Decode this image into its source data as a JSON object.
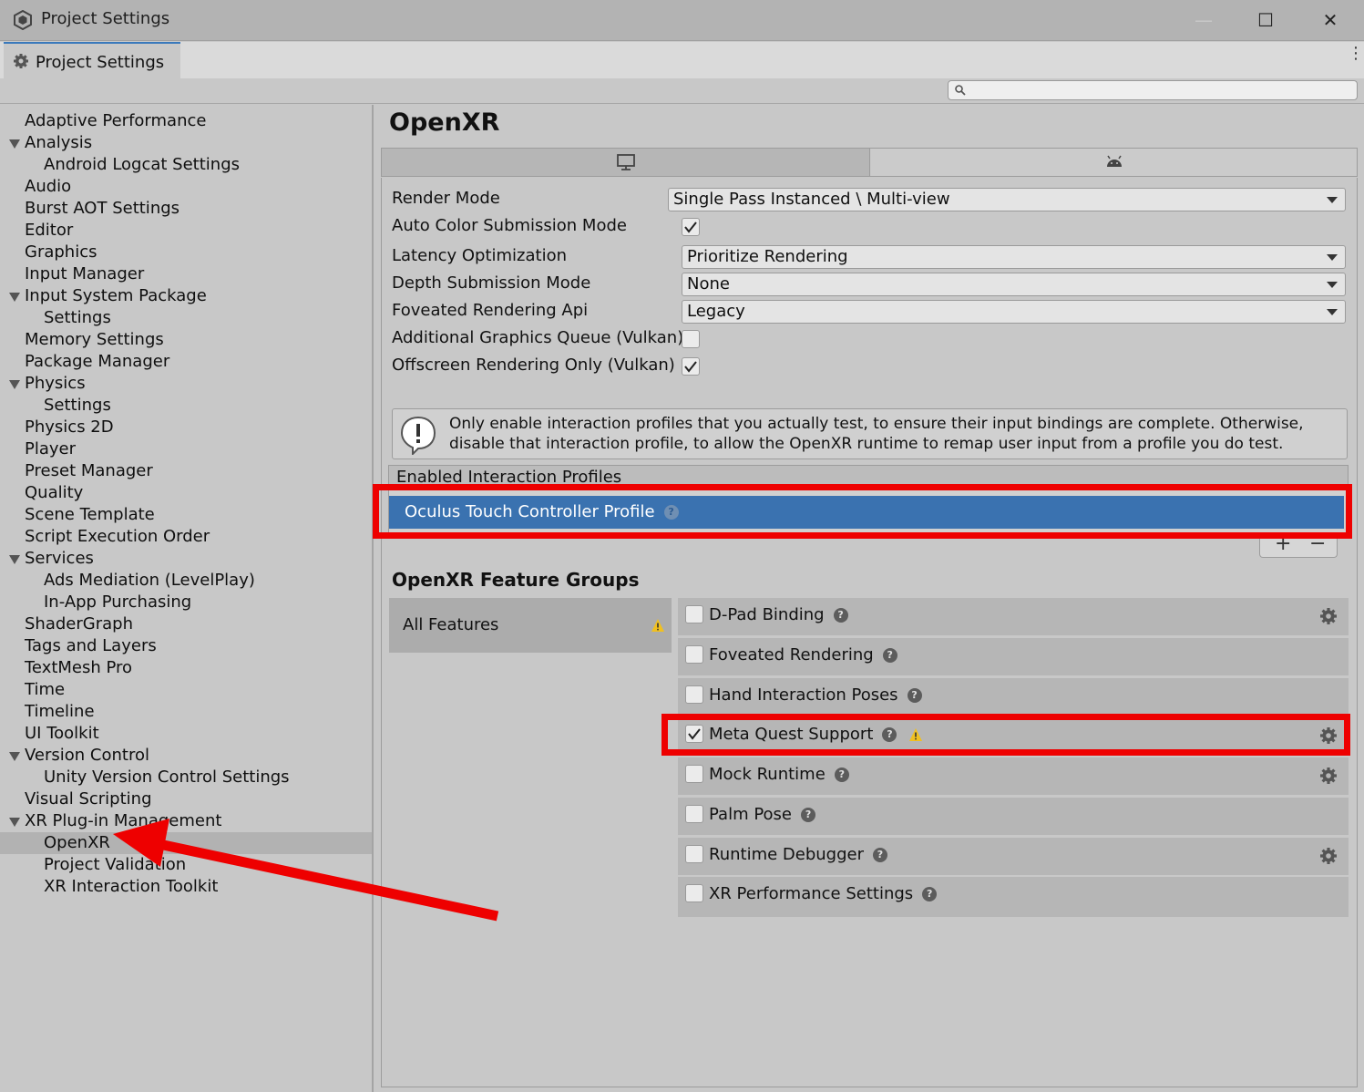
{
  "window": {
    "title": "Project Settings",
    "controls": {
      "minimize": "—",
      "maximize": "☐",
      "close": "✕"
    }
  },
  "tab": {
    "label": "Project Settings",
    "icon": "gear-icon"
  },
  "search": {
    "placeholder": "",
    "value": "",
    "icon": "search-icon"
  },
  "sidebar": {
    "items": [
      {
        "label": "Adaptive Performance",
        "level": 0,
        "expanded": null,
        "selected": false
      },
      {
        "label": "Analysis",
        "level": 0,
        "expanded": true,
        "selected": false
      },
      {
        "label": "Android Logcat Settings",
        "level": 1,
        "expanded": null,
        "selected": false
      },
      {
        "label": "Audio",
        "level": 0,
        "expanded": null,
        "selected": false
      },
      {
        "label": "Burst AOT Settings",
        "level": 0,
        "expanded": null,
        "selected": false
      },
      {
        "label": "Editor",
        "level": 0,
        "expanded": null,
        "selected": false
      },
      {
        "label": "Graphics",
        "level": 0,
        "expanded": null,
        "selected": false
      },
      {
        "label": "Input Manager",
        "level": 0,
        "expanded": null,
        "selected": false
      },
      {
        "label": "Input System Package",
        "level": 0,
        "expanded": true,
        "selected": false
      },
      {
        "label": "Settings",
        "level": 1,
        "expanded": null,
        "selected": false
      },
      {
        "label": "Memory Settings",
        "level": 0,
        "expanded": null,
        "selected": false
      },
      {
        "label": "Package Manager",
        "level": 0,
        "expanded": null,
        "selected": false
      },
      {
        "label": "Physics",
        "level": 0,
        "expanded": true,
        "selected": false
      },
      {
        "label": "Settings",
        "level": 1,
        "expanded": null,
        "selected": false
      },
      {
        "label": "Physics 2D",
        "level": 0,
        "expanded": null,
        "selected": false
      },
      {
        "label": "Player",
        "level": 0,
        "expanded": null,
        "selected": false
      },
      {
        "label": "Preset Manager",
        "level": 0,
        "expanded": null,
        "selected": false
      },
      {
        "label": "Quality",
        "level": 0,
        "expanded": null,
        "selected": false
      },
      {
        "label": "Scene Template",
        "level": 0,
        "expanded": null,
        "selected": false
      },
      {
        "label": "Script Execution Order",
        "level": 0,
        "expanded": null,
        "selected": false
      },
      {
        "label": "Services",
        "level": 0,
        "expanded": true,
        "selected": false
      },
      {
        "label": "Ads Mediation (LevelPlay)",
        "level": 1,
        "expanded": null,
        "selected": false
      },
      {
        "label": "In-App Purchasing",
        "level": 1,
        "expanded": null,
        "selected": false
      },
      {
        "label": "ShaderGraph",
        "level": 0,
        "expanded": null,
        "selected": false
      },
      {
        "label": "Tags and Layers",
        "level": 0,
        "expanded": null,
        "selected": false
      },
      {
        "label": "TextMesh Pro",
        "level": 0,
        "expanded": null,
        "selected": false
      },
      {
        "label": "Time",
        "level": 0,
        "expanded": null,
        "selected": false
      },
      {
        "label": "Timeline",
        "level": 0,
        "expanded": null,
        "selected": false
      },
      {
        "label": "UI Toolkit",
        "level": 0,
        "expanded": null,
        "selected": false
      },
      {
        "label": "Version Control",
        "level": 0,
        "expanded": true,
        "selected": false
      },
      {
        "label": "Unity Version Control Settings",
        "level": 1,
        "expanded": null,
        "selected": false
      },
      {
        "label": "Visual Scripting",
        "level": 0,
        "expanded": null,
        "selected": false
      },
      {
        "label": "XR Plug-in Management",
        "level": 0,
        "expanded": true,
        "selected": false
      },
      {
        "label": "OpenXR",
        "level": 1,
        "expanded": null,
        "selected": true
      },
      {
        "label": "Project Validation",
        "level": 1,
        "expanded": null,
        "selected": false
      },
      {
        "label": "XR Interaction Toolkit",
        "level": 1,
        "expanded": null,
        "selected": false
      }
    ]
  },
  "main": {
    "title": "OpenXR",
    "platform_tabs": [
      {
        "icon": "monitor-icon",
        "active": false
      },
      {
        "icon": "android-icon",
        "active": true
      }
    ],
    "properties": {
      "render_mode": {
        "label": "Render Mode",
        "value": "Single Pass Instanced \\ Multi-view"
      },
      "auto_color": {
        "label": "Auto Color Submission Mode",
        "checked": true
      },
      "latency": {
        "label": "Latency Optimization",
        "value": "Prioritize Rendering"
      },
      "depth": {
        "label": "Depth Submission Mode",
        "value": "None"
      },
      "foveated_api": {
        "label": "Foveated Rendering Api",
        "value": "Legacy"
      },
      "additional_queue": {
        "label": "Additional Graphics Queue (Vulkan)",
        "checked": false
      },
      "offscreen": {
        "label": "Offscreen Rendering Only (Vulkan)",
        "checked": true
      }
    },
    "help_text": "Only enable interaction profiles that you actually test, to ensure their input bindings are complete. Otherwise, disable that interaction profile, to allow the OpenXR runtime to remap user input from a profile you do test.",
    "profiles": {
      "header": "Enabled Interaction Profiles",
      "items": [
        {
          "label": "Oculus Touch Controller Profile",
          "selected": true
        }
      ],
      "add": "+",
      "remove": "−"
    },
    "feature_groups": {
      "title": "OpenXR Feature Groups",
      "groups": [
        {
          "label": "All Features",
          "warning": true
        }
      ],
      "features": [
        {
          "label": "D-Pad Binding",
          "checked": false,
          "warning": false,
          "settings": true
        },
        {
          "label": "Foveated Rendering",
          "checked": false,
          "warning": false,
          "settings": false
        },
        {
          "label": "Hand Interaction Poses",
          "checked": false,
          "warning": false,
          "settings": false
        },
        {
          "label": "Meta Quest Support",
          "checked": true,
          "warning": true,
          "settings": true
        },
        {
          "label": "Mock Runtime",
          "checked": false,
          "warning": false,
          "settings": true
        },
        {
          "label": "Palm Pose",
          "checked": false,
          "warning": false,
          "settings": false
        },
        {
          "label": "Runtime Debugger",
          "checked": false,
          "warning": false,
          "settings": true
        },
        {
          "label": "XR Performance Settings",
          "checked": false,
          "warning": false,
          "settings": false
        }
      ]
    }
  },
  "annotations": {
    "highlight_color": "#ee0000",
    "accent": "#3a72b0"
  }
}
